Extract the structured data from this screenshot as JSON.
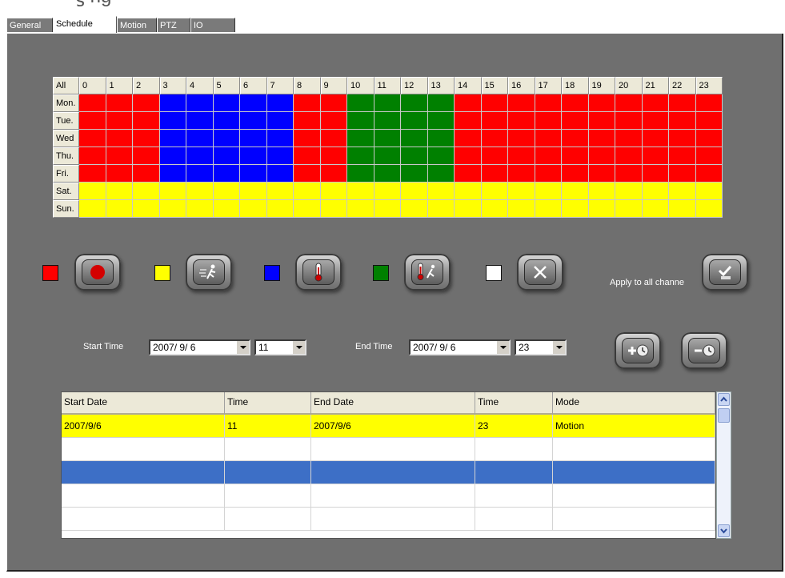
{
  "tabs": [
    "General",
    "Schedule",
    "Motion",
    "PTZ",
    "IO"
  ],
  "active_tab": "Schedule",
  "grid": {
    "corner": "All",
    "hours": [
      "0",
      "1",
      "2",
      "3",
      "4",
      "5",
      "6",
      "7",
      "8",
      "9",
      "10",
      "11",
      "12",
      "13",
      "14",
      "15",
      "16",
      "17",
      "18",
      "19",
      "20",
      "21",
      "22",
      "23"
    ],
    "days": [
      "Mon.",
      "Tue.",
      "Wed",
      "Thu.",
      "Fri.",
      "Sat.",
      "Sun."
    ],
    "colors": {
      "R": "#ff0000",
      "B": "#0000ff",
      "G": "#008000",
      "Y": "#ffff00",
      "W": "#ffffff"
    },
    "rows": [
      "RRRBBBBBRRGGGGRRRRRRRRRR",
      "RRRBBBBBRRGGGGRRRRRRRRRR",
      "RRRBBBBBRRGGGGRRRRRRRRRR",
      "RRRBBBBBRRGGGGRRRRRRRRRR",
      "RRRBBBBBRRGGGGRRRRRRRRRR",
      "YYYYYYYYYYYYYYYYYYYYYYYY",
      "YYYYYYYYYYYYYYYYYYYYYYYY"
    ]
  },
  "legend": [
    {
      "color": "#ff0000",
      "icon": "record-icon"
    },
    {
      "color": "#ffff00",
      "icon": "motion-icon"
    },
    {
      "color": "#0000ff",
      "icon": "thermometer-icon"
    },
    {
      "color": "#008000",
      "icon": "thermometer-motion-icon"
    },
    {
      "color": "#ffffff",
      "icon": "clear-icon"
    }
  ],
  "apply_all_label": "Apply to all channe",
  "start_time": {
    "label": "Start Time",
    "date": "2007/ 9/ 6",
    "hour": "11"
  },
  "end_time": {
    "label": "End Time",
    "date": "2007/ 9/ 6",
    "hour": "23"
  },
  "table": {
    "columns": [
      "Start Date",
      "Time",
      "End Date",
      "Time",
      "Mode"
    ],
    "rows": [
      [
        "2007/9/6",
        "11",
        "2007/9/6",
        "23",
        "Motion"
      ],
      [
        "",
        "",
        "",
        "",
        ""
      ],
      [
        "",
        "",
        "",
        "",
        ""
      ],
      [
        "",
        "",
        "",
        "",
        ""
      ],
      [
        "",
        "",
        "",
        "",
        ""
      ]
    ],
    "highlight_row_color": "#ffff00",
    "selected_row_color": "#3d6fc6"
  }
}
